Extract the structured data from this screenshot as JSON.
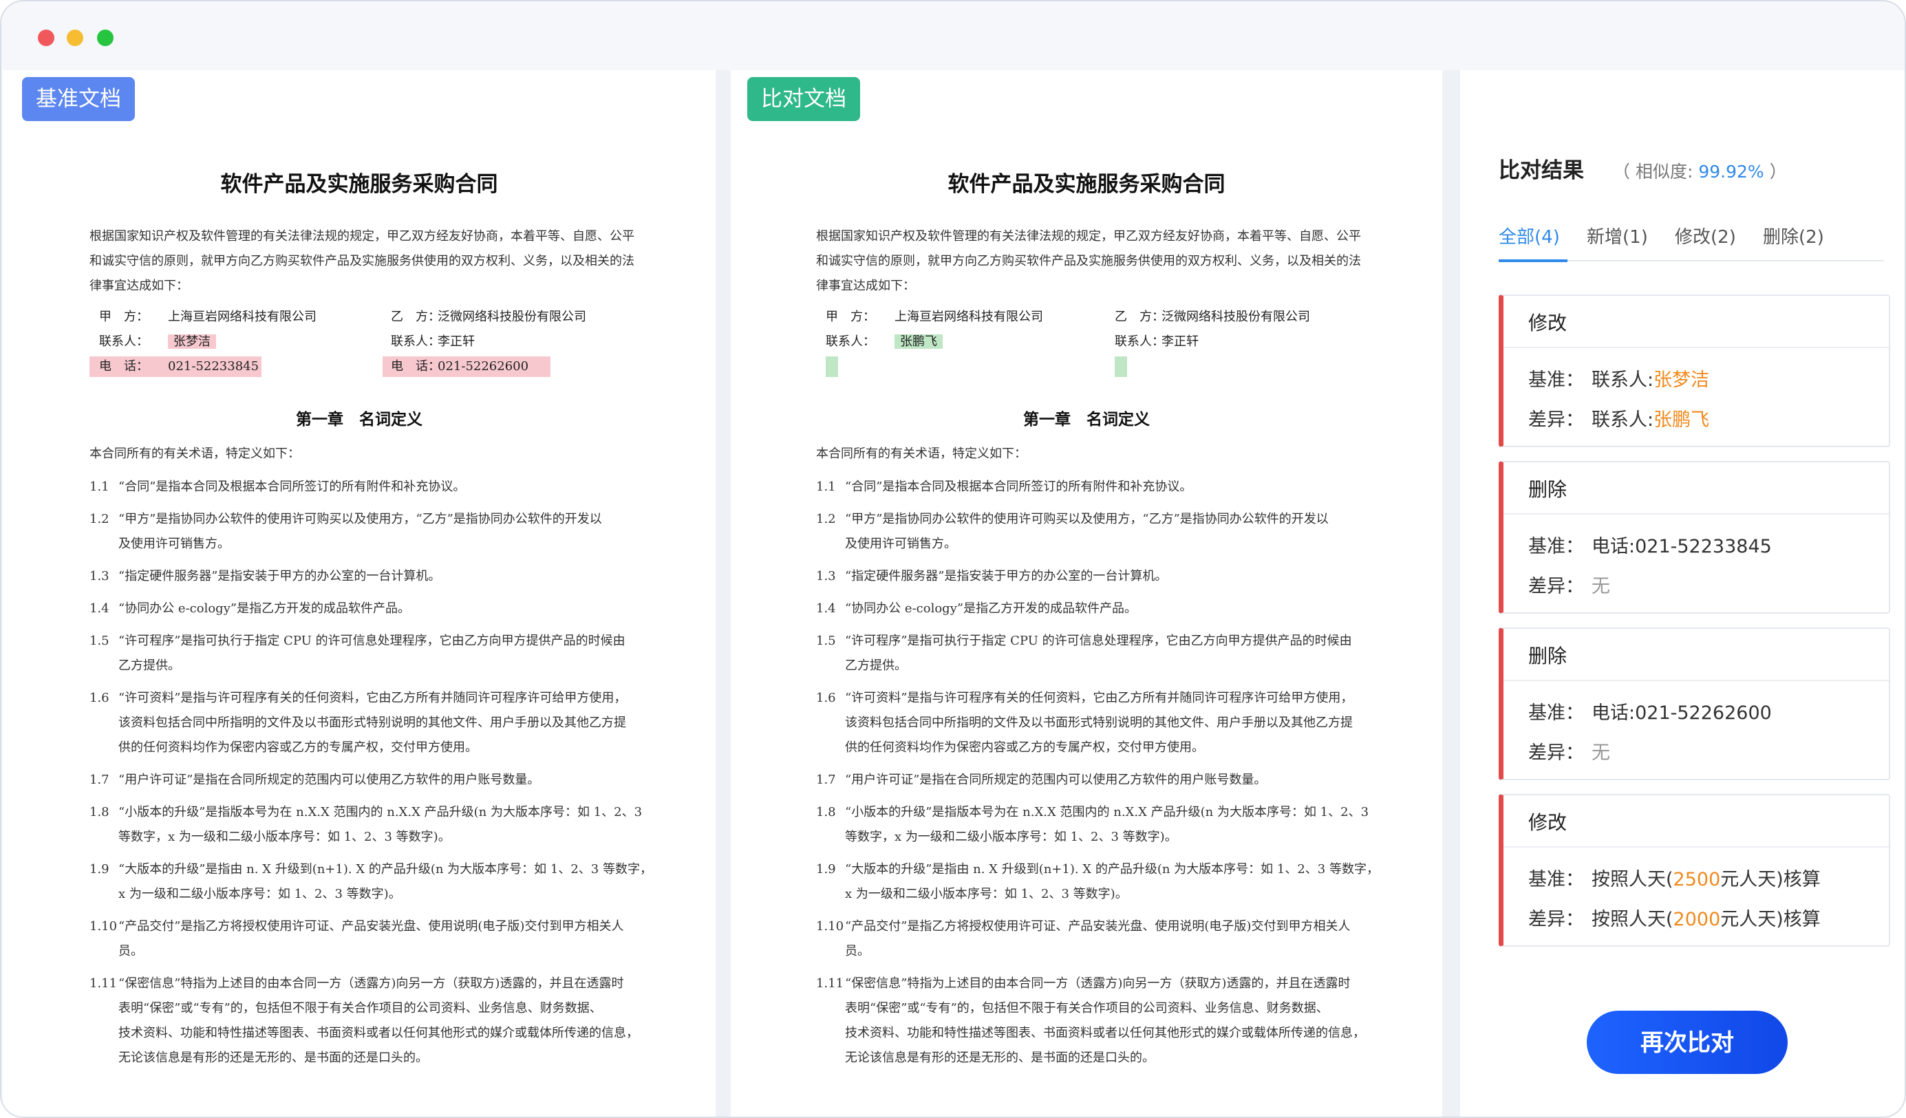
{
  "left_doc": {
    "tag": "基准文档",
    "title": "软件产品及实施服务采购合同",
    "intro": [
      "根据国家知识产权及软件管理的有关法律法规的规定，甲乙双方经友好协商，本着平等、自愿、公平",
      "和诚实守信的原则，就甲方向乙方购买软件产品及实施服务供使用的双方权利、义务，以及相关的法",
      "律事宜达成如下："
    ],
    "party_a": {
      "label": "甲　方：",
      "name": "上海亘岩网络科技有限公司",
      "contact_label": "联系人：",
      "contact": "张梦洁",
      "phone_label": "电　话：",
      "phone": "021-52233845"
    },
    "party_b": {
      "label": "乙　方：",
      "name": "泛微网络科技股份有限公司",
      "contact_label": "联系人：",
      "contact": "李正轩",
      "phone_label": "电　话：",
      "phone": "021-52262600"
    }
  },
  "right_doc": {
    "tag": "比对文档",
    "title": "软件产品及实施服务采购合同",
    "intro": [
      "根据国家知识产权及软件管理的有关法律法规的规定，甲乙双方经友好协商，本着平等、自愿、公平",
      "和诚实守信的原则，就甲方向乙方购买软件产品及实施服务供使用的双方权利、义务，以及相关的法",
      "律事宜达成如下："
    ],
    "party_a": {
      "label": "甲　方：",
      "name": "上海亘岩网络科技有限公司",
      "contact_label": "联系人：",
      "contact": "张鹏飞"
    },
    "party_b": {
      "label": "乙　方：",
      "name": "泛微网络科技股份有限公司",
      "contact_label": "联系人：",
      "contact": "李正轩"
    }
  },
  "chapter": "第一章　名词定义",
  "definitions_intro": "本合同所有的有关术语，特定义如下：",
  "clauses": [
    {
      "num": "1.1",
      "lines": [
        "“合同”是指本合同及根据本合同所签订的所有附件和补充协议。"
      ]
    },
    {
      "num": "1.2",
      "lines": [
        "“甲方”是指协同办公软件的使用许可购买以及使用方，“乙方”是指协同办公软件的开发以",
        "及使用许可销售方。"
      ]
    },
    {
      "num": "1.3",
      "lines": [
        "“指定硬件服务器”是指安装于甲方的办公室的一台计算机。"
      ]
    },
    {
      "num": "1.4",
      "lines": [
        "“协同办公 e-cology”是指乙方开发的成品软件产品。"
      ]
    },
    {
      "num": "1.5",
      "lines": [
        "“许可程序”是指可执行于指定 CPU 的许可信息处理程序，它由乙方向甲方提供产品的时候由",
        "乙方提供。"
      ]
    },
    {
      "num": "1.6",
      "lines": [
        "“许可资料”是指与许可程序有关的任何资料，它由乙方所有并随同许可程序许可给甲方使用，",
        "该资料包括合同中所指明的文件及以书面形式特别说明的其他文件、用户手册以及其他乙方提",
        "供的任何资料均作为保密内容或乙方的专属产权，交付甲方使用。"
      ]
    },
    {
      "num": "1.7",
      "lines": [
        "“用户许可证”是指在合同所规定的范围内可以使用乙方软件的用户账号数量。"
      ]
    },
    {
      "num": "1.8",
      "lines": [
        "“小版本的升级”是指版本号为在 n.X.X 范围内的 n.X.X 产品升级(n 为大版本序号：如 1、2、3",
        "等数字，x 为一级和二级小版本序号：如 1、2、3 等数字)。"
      ]
    },
    {
      "num": "1.9",
      "lines": [
        "“大版本的升级”是指由 n. X 升级到(n+1). X 的产品升级(n 为大版本序号：如 1、2、3 等数字，",
        "x 为一级和二级小版本序号：如 1、2、3 等数字)。"
      ]
    },
    {
      "num": "1.10",
      "lines": [
        "“产品交付”是指乙方将授权使用许可证、产品安装光盘、使用说明(电子版)交付到甲方相关人",
        "员。"
      ]
    },
    {
      "num": "1.11",
      "lines": [
        "“保密信息”特指为上述目的由本合同一方（透露方)向另一方（获取方)透露的，并且在透露时",
        "表明“保密”或“专有”的，包括但不限于有关合作项目的公司资料、业务信息、财务数据、",
        "技术资料、功能和特性描述等图表、书面资料或者以任何其他形式的媒介或载体所传递的信息，",
        "无论该信息是有形的还是无形的、是书面的还是口头的。"
      ]
    }
  ],
  "results": {
    "title": "比对结果",
    "similarity_prefix": "（ 相似度: ",
    "similarity": "99.92%",
    "similarity_suffix": " ）",
    "filters": [
      {
        "label": "全部",
        "count": "(4)",
        "active": true
      },
      {
        "label": "新增",
        "count": "(1)",
        "active": false
      },
      {
        "label": "修改",
        "count": "(2)",
        "active": false
      },
      {
        "label": "删除",
        "count": "(2)",
        "active": false
      }
    ],
    "base_label": "基准：",
    "diff_label": "差异：",
    "cards": [
      {
        "type": "修改",
        "base_pre": "联系人:",
        "base_chg": "张梦洁",
        "base_post": "",
        "diff_pre": "联系人:",
        "diff_chg": "张鹏飞",
        "diff_post": ""
      },
      {
        "type": "删除",
        "base_pre": "电话:021-52233845",
        "base_chg": "",
        "base_post": "",
        "diff_none": "无"
      },
      {
        "type": "删除",
        "base_pre": "电话:021-52262600",
        "base_chg": "",
        "base_post": "",
        "diff_none": "无"
      },
      {
        "type": "修改",
        "base_pre": "按照人天(",
        "base_chg": "2500",
        "base_post": "元人天)核算",
        "diff_pre": "按照人天(",
        "diff_chg": "2000",
        "diff_post": "元人天)核算"
      }
    ],
    "recompare_label": "再次比对"
  },
  "colors": {
    "accent": "#2f8ae8",
    "change": "#f08a1e",
    "deleted_highlight": "#f7c9cf",
    "added_highlight": "#bfe7c5",
    "card_marker": "#e24a4a"
  }
}
